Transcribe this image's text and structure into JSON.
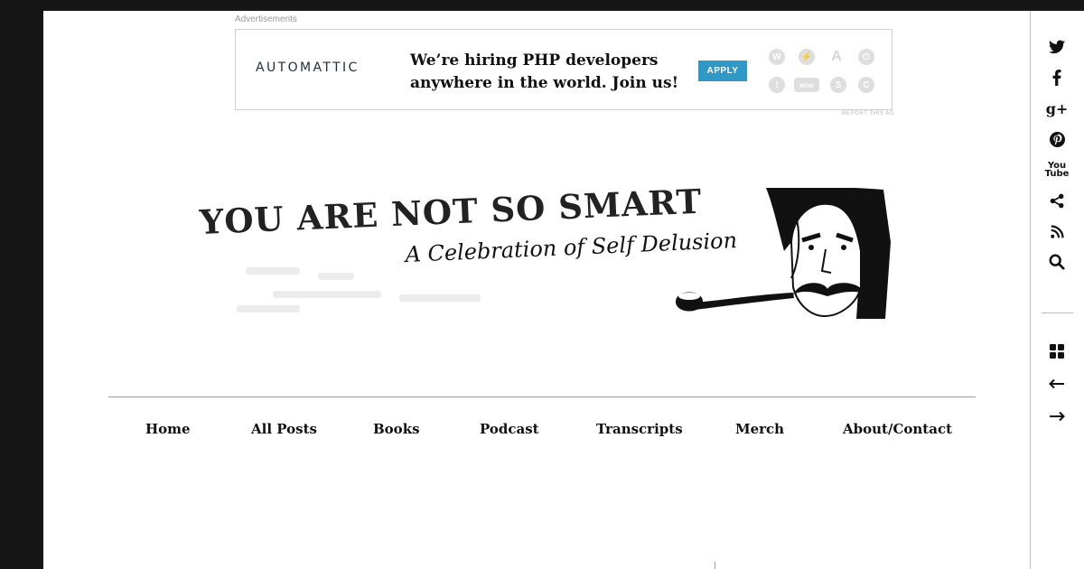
{
  "ad": {
    "label": "Advertisements",
    "brand": "AUTOMATTIC",
    "headline": "We’re hiring PHP developers anywhere in the world. Join us!",
    "apply_label": "APPLY",
    "report_label": "REPORT THIS AD",
    "product_icons": [
      "wordpress-icon",
      "jetpack-icon",
      "akismet-icon",
      "vaultpress-icon",
      "simplenote-icon",
      "woocommerce-icon",
      "polldaddy-icon",
      "crowdsignal-icon"
    ]
  },
  "header": {
    "title": "YOU ARE NOT SO SMART",
    "tagline": "A Celebration of Self Delusion"
  },
  "nav": {
    "items": [
      {
        "label": "Home"
      },
      {
        "label": "All Posts"
      },
      {
        "label": "Books"
      },
      {
        "label": "Podcast"
      },
      {
        "label": "Transcripts"
      },
      {
        "label": "Merch"
      },
      {
        "label": "About/Contact"
      }
    ]
  },
  "sidebar": {
    "social_icons": [
      "twitter-icon",
      "facebook-icon",
      "google-plus-icon",
      "pinterest-icon",
      "youtube-icon",
      "share-icon",
      "rss-icon",
      "search-icon"
    ],
    "post_nav_icons": [
      "grid-icon",
      "arrow-left-icon",
      "arrow-right-icon"
    ]
  }
}
